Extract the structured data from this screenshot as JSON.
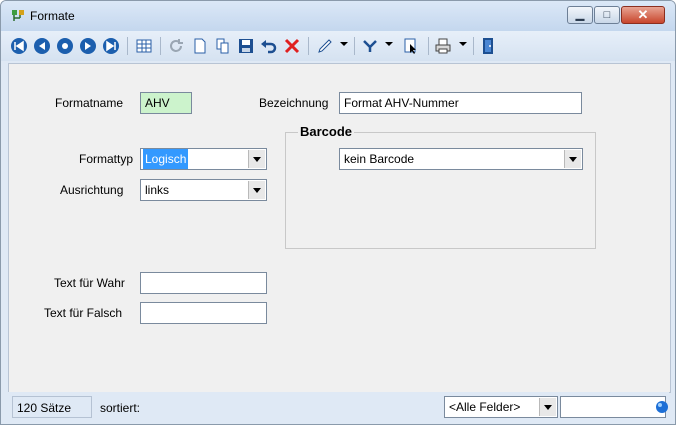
{
  "window": {
    "title": "Formate"
  },
  "toolbar": {
    "icons": [
      "first-record",
      "previous-record",
      "next-record",
      "last-record",
      "new-record",
      "table-view",
      "refresh",
      "new-document",
      "copy",
      "save",
      "undo",
      "delete",
      "edit",
      "filter",
      "select",
      "print",
      "exit"
    ]
  },
  "form": {
    "formatname_label": "Formatname",
    "formatname_value": "AHV",
    "bezeichnung_label": "Bezeichnung",
    "bezeichnung_value": "Format AHV-Nummer",
    "formattyp_label": "Formattyp",
    "formattyp_value": "Logisch",
    "ausrichtung_label": "Ausrichtung",
    "ausrichtung_value": "links",
    "text_wahr_label": "Text für Wahr",
    "text_wahr_value": "",
    "text_falsch_label": "Text für Falsch",
    "text_falsch_value": "",
    "barcode_group_label": "Barcode",
    "barcode_value": "kein Barcode"
  },
  "status": {
    "record_count": "120 Sätze",
    "sort_label": "sortiert:",
    "field_filter": "<Alle Felder>"
  },
  "colors": {
    "selected_highlight": "#3399ff",
    "key_field_bg": "#ccf3cc",
    "close_button": "#c8452c"
  }
}
